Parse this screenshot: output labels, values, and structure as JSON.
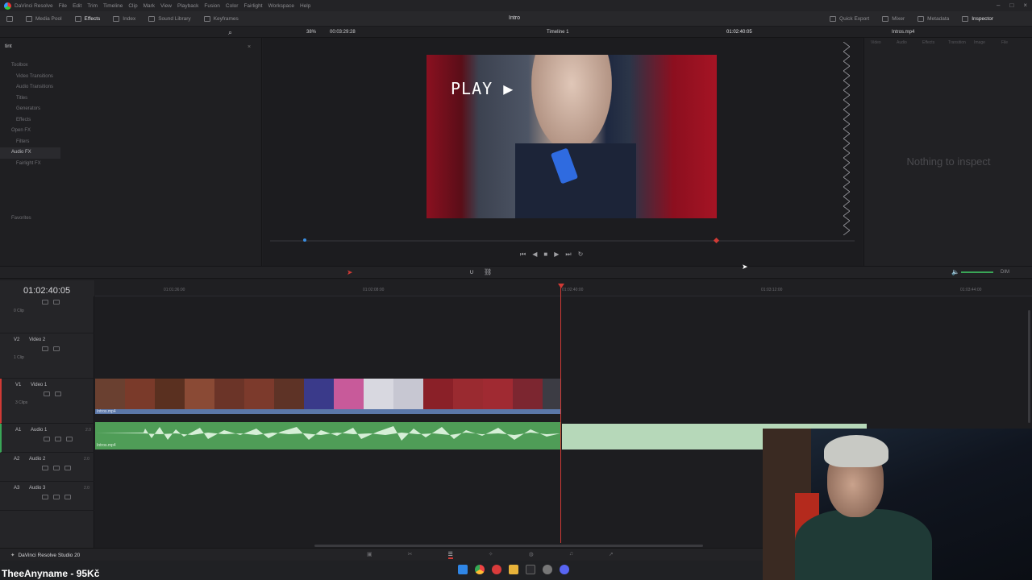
{
  "app": {
    "name": "DaVinci Resolve",
    "studio_label": "DaVinci Resolve Studio 20",
    "project_title": "Intro"
  },
  "menu": [
    "File",
    "Edit",
    "Trim",
    "Timeline",
    "Clip",
    "Mark",
    "View",
    "Playback",
    "Fusion",
    "Color",
    "Fairlight",
    "Workspace",
    "Help"
  ],
  "toolbar": {
    "left": [
      "Media Pool",
      "Effects",
      "Index",
      "Sound Library",
      "Keyframes"
    ],
    "right": [
      "Quick Export",
      "Mixer",
      "Metadata",
      "Inspector"
    ]
  },
  "viewer": {
    "zoom": "38%",
    "source_tc": "00:03:29:28",
    "timeline_name": "Timeline 1",
    "record_tc": "01:02:40:05",
    "overlay_text": "PLAY"
  },
  "inspector": {
    "clip_name": "Intros.mp4",
    "tabs": [
      "Video",
      "Audio",
      "Effects",
      "Transition",
      "Image",
      "File"
    ],
    "empty_text": "Nothing to inspect"
  },
  "effects": {
    "search_value": "tint",
    "tree": [
      {
        "label": "Toolbox",
        "expanded": true
      },
      {
        "label": "Video Transitions"
      },
      {
        "label": "Audio Transitions"
      },
      {
        "label": "Titles"
      },
      {
        "label": "Generators"
      },
      {
        "label": "Effects"
      },
      {
        "label": "Open FX",
        "expanded": true
      },
      {
        "label": "Filters"
      },
      {
        "label": "Audio FX",
        "selected": true
      },
      {
        "label": "Fairlight FX"
      }
    ],
    "favorites": "Favorites"
  },
  "timeline": {
    "current_tc": "01:02:40:05",
    "ruler": [
      "01:01:36:00",
      "01:02:08:00",
      "01:02:40:00",
      "01:03:12:00",
      "01:03:44:00"
    ],
    "tracks": [
      {
        "id": "",
        "name": "",
        "count": "0 Clip"
      },
      {
        "id": "V2",
        "name": "Video 2",
        "count": "1 Clip"
      },
      {
        "id": "V1",
        "name": "Video 1",
        "count": "3 Clips"
      },
      {
        "id": "A1",
        "name": "Audio 1",
        "level": "2.0",
        "count": ""
      },
      {
        "id": "A2",
        "name": "Audio 2",
        "level": "2.0",
        "count": ""
      },
      {
        "id": "A3",
        "name": "Audio 3",
        "level": "2.0",
        "count": ""
      }
    ],
    "video_clip_label": "Intros.mp4",
    "audio_clip_label": "Intros.mp4",
    "dim_label": "DIM"
  },
  "overlay": {
    "streamer_name": "TheeAnyname - 95Kč"
  },
  "colors": {
    "accent": "#d03a35",
    "video_clip": "#5b77a8",
    "audio_clip": "#4f9d57"
  }
}
